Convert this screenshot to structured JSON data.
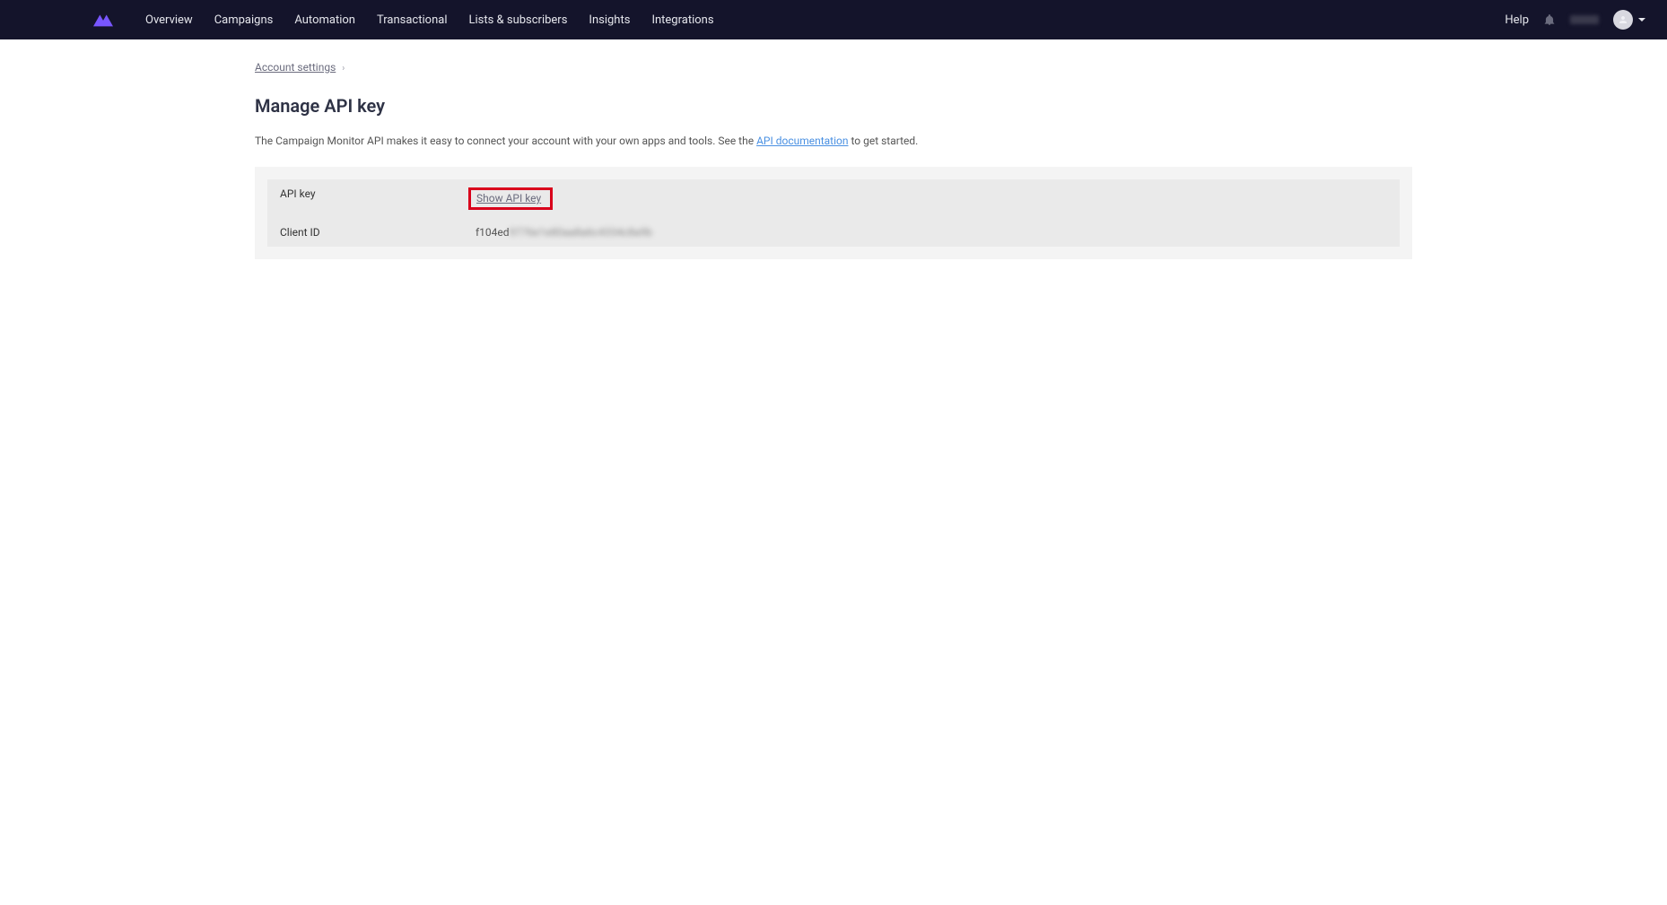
{
  "nav": {
    "items": [
      "Overview",
      "Campaigns",
      "Automation",
      "Transactional",
      "Lists & subscribers",
      "Insights",
      "Integrations"
    ],
    "help": "Help"
  },
  "breadcrumb": {
    "link": "Account settings",
    "sep": "›"
  },
  "page": {
    "title": "Manage API key",
    "desc_1": "The Campaign Monitor API makes it easy to connect your account with your own apps and tools. See the ",
    "desc_link": "API documentation",
    "desc_2": " to get started."
  },
  "rows": {
    "apikey_label": "API key",
    "apikey_action": "Show API key",
    "clientid_label": "Client ID",
    "clientid_prefix": "f104ed",
    "clientid_blur": "9776e1e80aa8a6c4334c8a9b"
  }
}
